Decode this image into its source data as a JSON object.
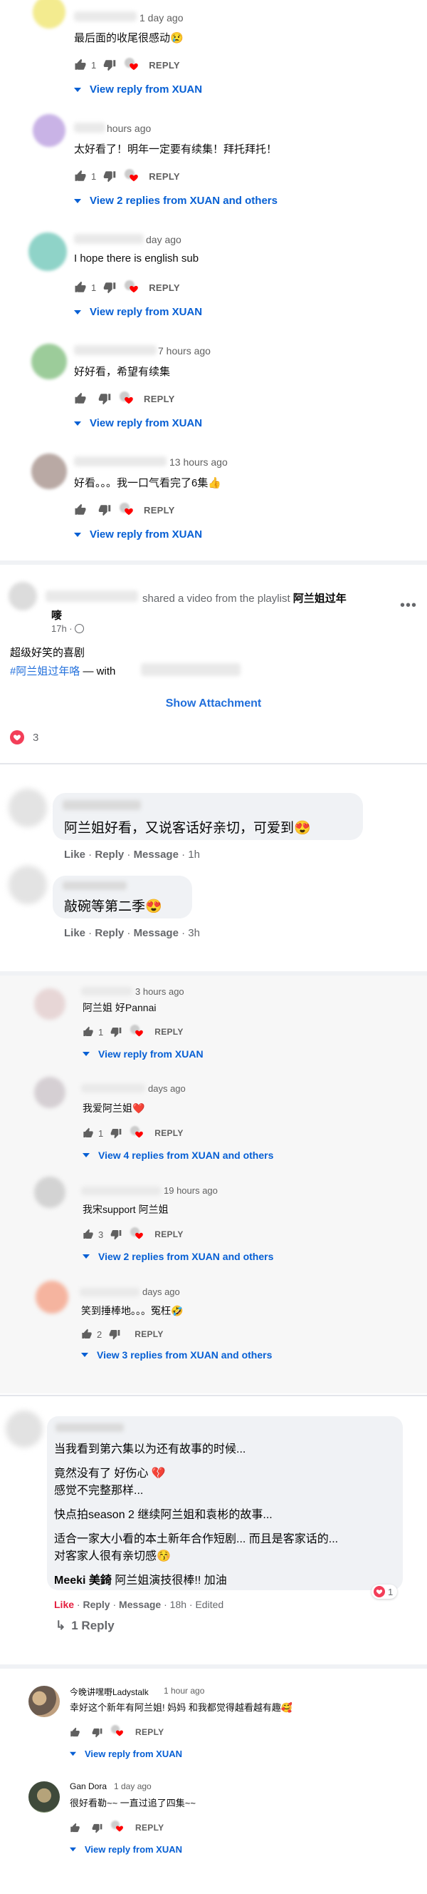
{
  "reply_count_labels": {
    "reply": "REPLY"
  },
  "yt_group1": {
    "comments": [
      {
        "meta": "1 day ago",
        "text": "最后面的收尾很感动😢",
        "likes": "1",
        "replies": "View reply from XUAN"
      },
      {
        "meta": "hours ago",
        "text": "太好看了！明年一定要有续集！拜托拜托！",
        "likes": "1",
        "replies": "View 2 replies from XUAN and others"
      },
      {
        "meta": "day ago",
        "text": "I hope there is english sub",
        "likes": "1",
        "replies": "View reply from XUAN"
      },
      {
        "meta": "7 hours ago",
        "text": "好好看，希望有续集",
        "likes": "",
        "replies": "View reply from XUAN"
      },
      {
        "meta": "13 hours ago",
        "text": "好看。。。我一口气看完了6集👍",
        "likes": "",
        "replies": "View reply from XUAN"
      }
    ]
  },
  "fb_post": {
    "header_suffix": "shared a video from the playlist",
    "playlist_name": "阿兰姐过年",
    "playlist_name_cont": "嘜",
    "time": "17h · ",
    "text_line1": "超级好笑的喜剧",
    "hashtag": "#阿兰姐过年咯",
    "with_text": "— with",
    "show_attachment": "Show Attachment",
    "reactions": "3",
    "more_icon": "more-dots-icon"
  },
  "fb_comments": [
    {
      "text": "阿兰姐好看，又说客话好亲切，可爱到😍",
      "like": "Like",
      "reply": "Reply",
      "message": "Message",
      "time": "1h"
    },
    {
      "text": "敲碗等第二季😍",
      "like": "Like",
      "reply": "Reply",
      "message": "Message",
      "time": "3h"
    }
  ],
  "yt_group2": {
    "comments": [
      {
        "meta": "3 hours ago",
        "text": "阿兰姐 好Pannai",
        "likes": "1",
        "replies": "View reply from XUAN"
      },
      {
        "meta": "days ago",
        "text": "我爱阿兰姐❤️",
        "likes": "1",
        "replies": "View 4 replies from XUAN and others"
      },
      {
        "meta": "19 hours ago",
        "text": "我宋support 阿兰姐",
        "likes": "3",
        "replies": "View 2 replies from XUAN and others"
      },
      {
        "meta": "days ago",
        "text": "笑到捶棒地。。。冤枉🤣",
        "likes": "2",
        "replies": "View 3 replies from XUAN and others"
      }
    ]
  },
  "fb_long_comment": {
    "lines": [
      "当我看到第六集以为还有故事的时候...",
      "竟然没有了 好伤心 💔",
      "感觉不完整那样...",
      "快点拍season 2 继续阿兰姐和袁彬的故事...",
      "适合一家大小看的本土新年合作短剧... 而且是客家话的...",
      "对客家人很有亲切感😚"
    ],
    "mention": "Meeki 美錡",
    "mention_suffix": " 阿兰姐演技很棒!! 加油",
    "like": "Like",
    "reply": "Reply",
    "message": "Message",
    "time": "18h",
    "edited": "Edited",
    "reaction_count": "1",
    "replies_link": "1 Reply"
  },
  "yt_group3": {
    "comments": [
      {
        "author": "今晚讲嘿嘢Ladystalk",
        "meta": "1 hour ago",
        "text": "幸好这个新年有阿兰姐! 妈妈 和我都觉得越看越有趣🥰",
        "likes": "",
        "replies": "View reply from XUAN"
      },
      {
        "author": "Gan Dora",
        "meta": "1 day ago",
        "text": "很好看勒~~ 一直过追了四集~~",
        "likes": "",
        "replies": "View reply from XUAN"
      }
    ]
  },
  "colors": {
    "link_blue": "#065fd4",
    "fb_blue": "#216fdb",
    "heart_red": "#ff0000"
  }
}
